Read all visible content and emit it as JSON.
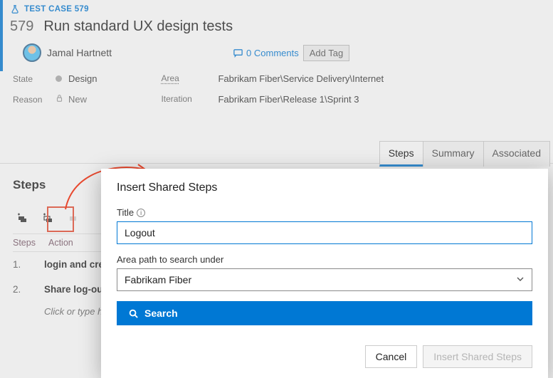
{
  "breadcrumb": {
    "label": "TEST CASE 579"
  },
  "workitem": {
    "id": "579",
    "title": "Run standard UX design tests"
  },
  "assignee": {
    "name": "Jamal Hartnett"
  },
  "comments": {
    "label": "0 Comments"
  },
  "tags": {
    "add_label": "Add Tag"
  },
  "fields": {
    "state_label": "State",
    "state_value": "Design",
    "reason_label": "Reason",
    "reason_value": "New",
    "area_label": "Area",
    "area_value": "Fabrikam Fiber\\Service Delivery\\Internet",
    "iteration_label": "Iteration",
    "iteration_value": "Fabrikam Fiber\\Release 1\\Sprint 3"
  },
  "tabs": {
    "steps": "Steps",
    "summary": "Summary",
    "associated": "Associated"
  },
  "steps": {
    "heading": "Steps",
    "col_steps": "Steps",
    "col_action": "Action",
    "rows": [
      {
        "num": "1.",
        "action": "login and create a lead"
      },
      {
        "num": "2.",
        "action": "Share log-out steps"
      }
    ],
    "hint": "Click or type here to add a step"
  },
  "dialog": {
    "title": "Insert Shared Steps",
    "title_field_label": "Title",
    "title_field_value": "Logout",
    "area_label": "Area path to search under",
    "area_value": "Fabrikam Fiber",
    "search_label": "Search",
    "cancel_label": "Cancel",
    "submit_label": "Insert Shared Steps"
  }
}
